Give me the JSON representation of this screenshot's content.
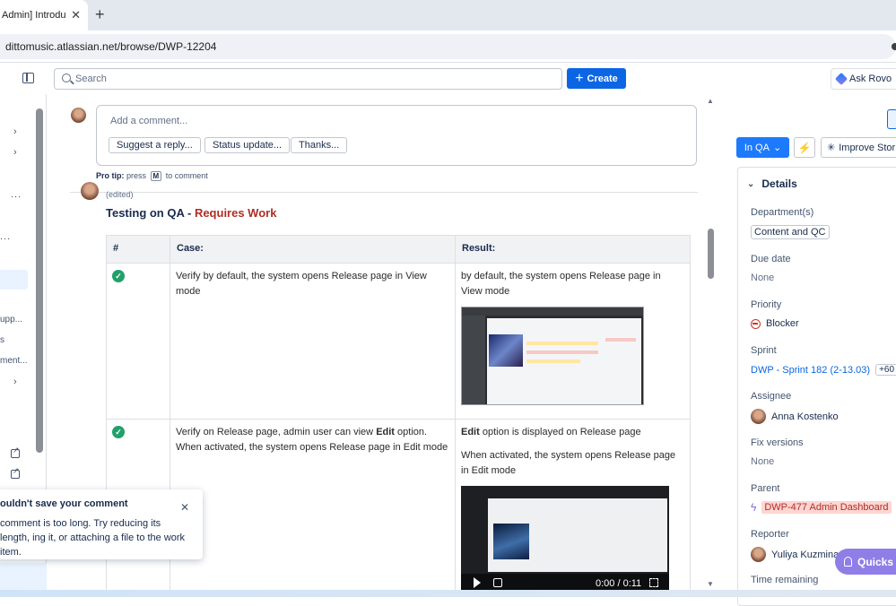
{
  "browser": {
    "tab_title": "Admin] Introduc",
    "tab_close": "✕",
    "new_tab": "+",
    "url": "dittomusic.atlassian.net/browse/DWP-12204"
  },
  "topnav": {
    "search_placeholder": "Search",
    "create_label": "Create",
    "ask_rovo_label": "Ask Rovo"
  },
  "sidebar": {
    "items": [
      {
        "label": "upp..."
      },
      {
        "label": "s"
      },
      {
        "label": "ment..."
      }
    ],
    "chevrons": [
      "›",
      "›",
      "›"
    ],
    "dots": [
      "...",
      "..."
    ]
  },
  "toast": {
    "title": "ouldn't save your comment",
    "body": "comment is too long. Try reducing its length, ing it, or attaching a file to the work item.",
    "close": "✕"
  },
  "comment": {
    "placeholder": "Add a comment...",
    "suggestions": [
      "Suggest a reply...",
      "Status update...",
      "Thanks..."
    ],
    "pro_tip_label": "Pro tip:",
    "pro_tip_pre": "press",
    "pro_tip_key": "M",
    "pro_tip_post": "to comment"
  },
  "qa_comment": {
    "edited": "(edited)",
    "title_main": "Testing on QA - ",
    "title_status": "Requires Work",
    "table": {
      "headers": [
        "#",
        "Case:",
        "Result:"
      ],
      "rows": [
        {
          "status": "pass",
          "case": "Verify by default, the system opens Release page in View mode",
          "result": [
            "by default, the system opens Release page in View mode"
          ]
        },
        {
          "status": "pass",
          "case_pre": "Verify on Release page, admin user can view ",
          "case_bold": "Edit",
          "case_post": " option. When activated, the system opens Release page in Edit mode",
          "result_bold": "Edit",
          "result_line1": " option is displayed on Release page",
          "result_line2": "When activated, the system opens Release page in Edit mode",
          "video_time": "0:00 / 0:11"
        }
      ]
    }
  },
  "right_panel": {
    "status_label": "In QA",
    "improve_label": "Improve Stor",
    "details_heading": "Details",
    "fields": {
      "department_label": "Department(s)",
      "department_value": "Content and QC",
      "due_date_label": "Due date",
      "due_date_value": "None",
      "priority_label": "Priority",
      "priority_value": "Blocker",
      "sprint_label": "Sprint",
      "sprint_value": "DWP - Sprint 182 (2-13.03)",
      "sprint_more": "+60",
      "assignee_label": "Assignee",
      "assignee_value": "Anna Kostenko",
      "fix_versions_label": "Fix versions",
      "fix_versions_value": "None",
      "parent_label": "Parent",
      "parent_value": "DWP-477 Admin Dashboard",
      "reporter_label": "Reporter",
      "reporter_value": "Yuliya Kuzmina",
      "time_remaining_label": "Time remaining"
    },
    "quickstart_label": "Quicks"
  }
}
